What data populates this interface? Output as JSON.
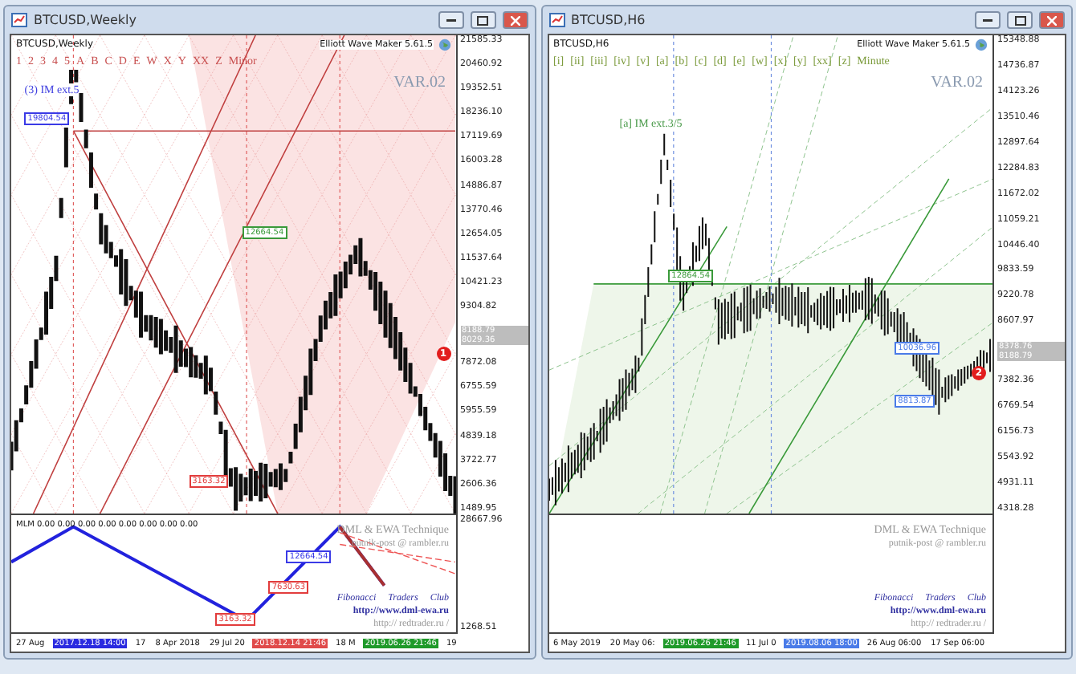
{
  "windows": [
    {
      "title": "BTCUSD,Weekly",
      "symbol": "BTCUSD,Weekly",
      "wave_degrees": [
        "1",
        "2",
        "3",
        "4",
        "5",
        "A",
        "B",
        "C",
        "D",
        "E",
        "W",
        "X",
        "Y",
        "XX",
        "Z"
      ],
      "degree_name": "Minor",
      "tool_name": "Elliott Wave Maker 5.61.5",
      "variant": "VAR.02",
      "annotation": "(3) IM ext.5",
      "price_tags": [
        "19804.54",
        "12664.54",
        "3163.32"
      ],
      "marker": "1",
      "price_axis": [
        "21585.33",
        "20460.92",
        "19352.51",
        "18236.10",
        "17119.69",
        "16003.28",
        "14886.87",
        "13770.46",
        "12654.05",
        "11537.64",
        "10421.23",
        "9304.82",
        "7872.08",
        "6755.59",
        "5955.59",
        "4839.18",
        "3722.77",
        "2606.36",
        "1489.95"
      ],
      "current_prices": [
        "8188.79",
        "8029.36"
      ],
      "indicator": {
        "label": "MLM 0.00 0.00 0.00 0.00 0.00 0.00 0.00 0.00",
        "axis": [
          "28667.96",
          "1268.51"
        ],
        "tags": [
          {
            "text": "12664.54",
            "color": "#3a3ae6"
          },
          {
            "text": "7630.63",
            "color": "#e23c3c"
          },
          {
            "text": "3163.32",
            "color": "#e23c3c"
          }
        ]
      },
      "credits": [
        "DML & EWA Technique",
        "putnik-post @ rambler.ru",
        "Fibonacci Traders Club",
        "http://www.dml-ewa.ru",
        "http:// redtrader.ru /"
      ],
      "time_axis": [
        {
          "text": "27 Aug",
          "kind": "plain"
        },
        {
          "text": "2017.12.18 14:00",
          "kind": "tag",
          "color": "#2a2ae0"
        },
        {
          "text": "17",
          "kind": "plain"
        },
        {
          "text": "8 Apr 2018",
          "kind": "plain"
        },
        {
          "text": "29 Jul 20",
          "kind": "plain"
        },
        {
          "text": "2018.12.14 21:46",
          "kind": "tag",
          "color": "#e04a4a"
        },
        {
          "text": "18 M",
          "kind": "plain"
        },
        {
          "text": "2019.06.26 21:46",
          "kind": "tag",
          "color": "#1f9a2a"
        },
        {
          "text": "19",
          "kind": "plain"
        }
      ]
    },
    {
      "title": "BTCUSD,H6",
      "symbol": "BTCUSD,H6",
      "wave_degrees": [
        "[i]",
        "[ii]",
        "[iii]",
        "[iv]",
        "[v]",
        "[a]",
        "[b]",
        "[c]",
        "[d]",
        "[e]",
        "[w]",
        "[x]",
        "[y]",
        "[xx]",
        "[z]"
      ],
      "degree_name": "Minute",
      "tool_name": "Elliott Wave Maker 5.61.5",
      "variant": "VAR.02",
      "annotation": "[a] IM ext.3/5",
      "price_tags": [
        "12864.54",
        "10036.96",
        "8813.87"
      ],
      "marker": "2",
      "price_axis": [
        "15348.88",
        "14736.87",
        "14123.26",
        "13510.46",
        "12897.64",
        "12284.83",
        "11672.02",
        "11059.21",
        "10446.40",
        "9833.59",
        "9220.78",
        "8607.97",
        "7382.36",
        "6769.54",
        "6156.73",
        "5543.92",
        "4931.11",
        "4318.28"
      ],
      "current_prices": [
        "8378.76",
        "8188.79"
      ],
      "credits": [
        "DML & EWA Technique",
        "putnik-post @ rambler.ru",
        "Fibonacci Traders Club",
        "http://www.dml-ewa.ru",
        "http:// redtrader.ru /"
      ],
      "time_axis": [
        {
          "text": "6 May 2019",
          "kind": "plain"
        },
        {
          "text": "20 May 06:",
          "kind": "plain"
        },
        {
          "text": "2019.06.26 21:46",
          "kind": "tag",
          "color": "#1f9a2a"
        },
        {
          "text": "11 Jul 0",
          "kind": "plain"
        },
        {
          "text": "2019.08.06 18:00",
          "kind": "tag",
          "color": "#4a7be8"
        },
        {
          "text": "26 Aug 06:00",
          "kind": "plain"
        },
        {
          "text": "17 Sep 06:00",
          "kind": "plain"
        }
      ]
    }
  ]
}
